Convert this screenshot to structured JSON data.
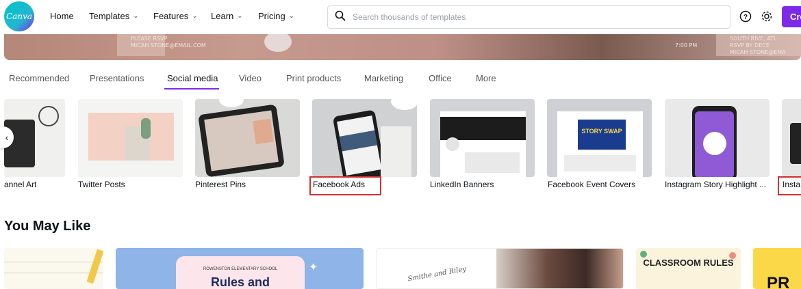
{
  "header": {
    "logo_text": "Canva",
    "nav": [
      {
        "label": "Home",
        "dropdown": false
      },
      {
        "label": "Templates",
        "dropdown": true
      },
      {
        "label": "Features",
        "dropdown": true
      },
      {
        "label": "Learn",
        "dropdown": true
      },
      {
        "label": "Pricing",
        "dropdown": true
      }
    ],
    "search_placeholder": "Search thousands of templates",
    "create_label": "Cre",
    "icons": [
      "search-icon",
      "help-icon",
      "settings-icon"
    ]
  },
  "banner": {
    "text_left": [
      "PLEASE RSVP",
      "MICAH STONE@EMAIL.COM"
    ],
    "text_mid": "7:00 PM",
    "text_right": [
      "SOUTH RIVE, ATL",
      "RSVP BY DECE",
      "MICAH STONE@EMA"
    ]
  },
  "tabs": [
    "Recommended",
    "Presentations",
    "Social media",
    "Video",
    "Print products",
    "Marketing",
    "Office",
    "More"
  ],
  "active_tab": "Social media",
  "categories": [
    "annel Art",
    "Twitter Posts",
    "Pinterest Pins",
    "Facebook Ads",
    "LinkedIn Banners",
    "Facebook Event Covers",
    "Instagram Story Highlight ...",
    "Insta"
  ],
  "category_thumb_text": {
    "story_swap": "STORY SWAP"
  },
  "section_title": "You May Like",
  "you_may_like": {
    "card2_text": "ROWENSTON ELEMENTARY SCHOOL",
    "card2_title": "Rules and",
    "card3_text": "Smithe and Riley",
    "card5_text": "CLASSROOM RULES",
    "card6_text": "PR"
  },
  "colors": {
    "brand": "#7d2ae8",
    "highlight": "#d32f2f",
    "logo": "#00c4cc"
  }
}
